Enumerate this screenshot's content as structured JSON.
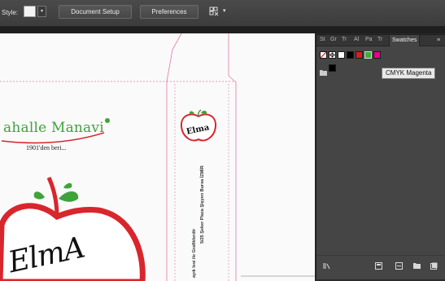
{
  "toolbar": {
    "style_label": "Style:",
    "document_setup": "Document Setup",
    "preferences": "Preferences",
    "dropdown_glyph": "▾",
    "arrange_dd": "▾"
  },
  "artwork": {
    "brand_name": "ahalle Manavi",
    "tagline": "1901'den beri...",
    "small_logo_text": "Elma",
    "big_logo_text": "ElmA",
    "vertical_line_1": "5/25 Şeker Plaza Şişyen Bursa İZMİR",
    "vertical_line_2": "ayık lesi ile Grafiklerdir"
  },
  "swatches_panel": {
    "tabs": [
      "St",
      "Gr",
      "Tr",
      "Al",
      "Pa",
      "Tr",
      "Swatches"
    ],
    "active_tab": "Swatches",
    "menu_glyph": "≡",
    "swatches": [
      {
        "name": "None",
        "color": "#ffffff"
      },
      {
        "name": "Registration",
        "color": "#ffffff"
      },
      {
        "name": "Paper",
        "color": "#ffffff"
      },
      {
        "name": "Black",
        "color": "#000000"
      },
      {
        "name": "Red",
        "color": "#d81e1e"
      },
      {
        "name": "Green",
        "color": "#3cae3c"
      },
      {
        "name": "CMYK Magenta",
        "color": "#ec008c"
      }
    ],
    "tooltip": "CMYK Magenta",
    "bottom_icons": [
      "library-icon",
      "folder-icon",
      "new-swatch-icon",
      "delete-icon"
    ]
  }
}
